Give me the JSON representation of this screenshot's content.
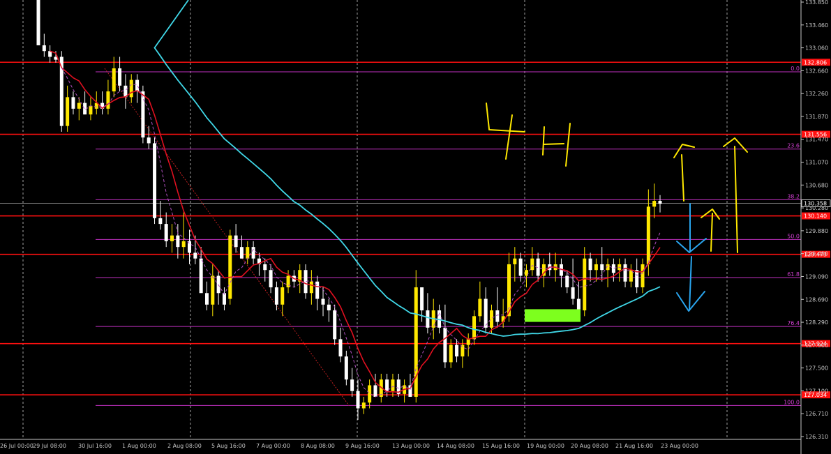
{
  "chart_data": {
    "type": "candlestick",
    "timeframe_annotation": "4H",
    "x_tick_labels": [
      "26 Jul 00:00",
      "29 Jul 08:00",
      "30 Jul 16:00",
      "1 Aug 00:00",
      "2 Aug 08:00",
      "5 Aug 16:00",
      "7 Aug 00:00",
      "8 Aug 08:00",
      "9 Aug 16:00",
      "13 Aug 00:00",
      "14 Aug 08:00",
      "15 Aug 16:00",
      "19 Aug 00:00",
      "20 Aug 08:00",
      "21 Aug 16:00",
      "23 Aug 00:00"
    ],
    "y_tick_labels": [
      "133.850",
      "133.460",
      "133.060",
      "132.660",
      "132.260",
      "131.870",
      "131.470",
      "131.070",
      "130.680",
      "130.280",
      "129.880",
      "129.490",
      "129.090",
      "128.690",
      "128.290",
      "127.900",
      "127.500",
      "127.100",
      "126.710",
      "126.310"
    ],
    "ylim": [
      126.2,
      133.95
    ],
    "current_price": 130.358,
    "horizontal_levels": [
      132.806,
      131.556,
      130.14,
      129.473,
      127.924,
      127.034
    ],
    "fibonacci_levels": [
      {
        "label": "0.0",
        "price": 132.64
      },
      {
        "label": "23.6",
        "price": 131.3
      },
      {
        "label": "38.2",
        "price": 130.42
      },
      {
        "label": "50.0",
        "price": 129.73
      },
      {
        "label": "61.8",
        "price": 129.07
      },
      {
        "label": "76.4",
        "price": 128.22
      },
      {
        "label": "100.0",
        "price": 126.85
      }
    ],
    "candles": [
      [
        133.9,
        134.1,
        133.7,
        133.1
      ],
      [
        133.1,
        133.3,
        132.9,
        133.0
      ],
      [
        133.0,
        133.1,
        132.8,
        132.9
      ],
      [
        132.9,
        133.0,
        132.8,
        132.85
      ],
      [
        132.9,
        133.0,
        131.6,
        131.7
      ],
      [
        131.7,
        132.4,
        131.6,
        132.2
      ],
      [
        132.2,
        132.3,
        131.9,
        132.0
      ],
      [
        132.0,
        132.2,
        131.8,
        132.1
      ],
      [
        132.1,
        132.3,
        131.9,
        131.9
      ],
      [
        131.9,
        132.2,
        131.8,
        132.05
      ],
      [
        132.0,
        132.3,
        131.9,
        132.1
      ],
      [
        132.1,
        132.3,
        131.9,
        132.0
      ],
      [
        132.0,
        132.5,
        131.9,
        132.3
      ],
      [
        132.3,
        132.9,
        132.2,
        132.7
      ],
      [
        132.7,
        132.9,
        132.3,
        132.4
      ],
      [
        132.4,
        132.6,
        132.0,
        132.2
      ],
      [
        132.2,
        132.6,
        132.1,
        132.5
      ],
      [
        132.5,
        132.6,
        132.1,
        132.3
      ],
      [
        132.3,
        132.4,
        131.4,
        131.5
      ],
      [
        131.5,
        131.7,
        131.3,
        131.4
      ],
      [
        131.4,
        131.5,
        130.0,
        130.1
      ],
      [
        130.1,
        130.4,
        129.9,
        130.0
      ],
      [
        130.0,
        130.2,
        129.6,
        129.7
      ],
      [
        129.7,
        130.0,
        129.5,
        129.8
      ],
      [
        129.8,
        130.0,
        129.4,
        129.6
      ],
      [
        129.6,
        130.2,
        129.4,
        129.7
      ],
      [
        129.7,
        129.9,
        129.3,
        129.5
      ],
      [
        129.5,
        129.8,
        129.3,
        129.4
      ],
      [
        129.4,
        129.6,
        128.9,
        128.8
      ],
      [
        128.8,
        129.0,
        128.5,
        128.6
      ],
      [
        128.6,
        129.3,
        128.4,
        129.1
      ],
      [
        129.1,
        129.2,
        128.6,
        128.8
      ],
      [
        128.8,
        128.9,
        128.5,
        128.6
      ],
      [
        128.7,
        129.9,
        128.6,
        129.8
      ],
      [
        129.8,
        130.0,
        129.5,
        129.6
      ],
      [
        129.6,
        129.8,
        129.4,
        129.4
      ],
      [
        129.4,
        129.7,
        129.3,
        129.6
      ],
      [
        129.6,
        129.7,
        129.3,
        129.4
      ],
      [
        129.4,
        129.5,
        129.1,
        129.3
      ],
      [
        129.3,
        129.4,
        129.0,
        129.2
      ],
      [
        129.2,
        129.3,
        128.8,
        128.9
      ],
      [
        128.9,
        129.0,
        128.5,
        128.6
      ],
      [
        128.6,
        129.0,
        128.4,
        128.9
      ],
      [
        128.9,
        129.2,
        128.8,
        129.1
      ],
      [
        129.1,
        129.2,
        128.9,
        129.0
      ],
      [
        129.0,
        129.3,
        128.8,
        129.2
      ],
      [
        129.2,
        129.3,
        128.7,
        128.8
      ],
      [
        128.8,
        129.2,
        128.6,
        129.0
      ],
      [
        129.0,
        129.1,
        128.5,
        128.7
      ],
      [
        128.7,
        128.9,
        128.4,
        128.6
      ],
      [
        128.6,
        128.7,
        128.3,
        128.5
      ],
      [
        128.5,
        128.6,
        127.9,
        128.0
      ],
      [
        128.0,
        128.2,
        127.6,
        127.7
      ],
      [
        127.7,
        127.8,
        127.2,
        127.3
      ],
      [
        127.3,
        127.5,
        127.0,
        127.1
      ],
      [
        127.1,
        127.3,
        126.6,
        126.8
      ],
      [
        126.8,
        127.0,
        126.7,
        126.9
      ],
      [
        126.9,
        127.3,
        126.8,
        127.2
      ],
      [
        127.2,
        127.4,
        127.0,
        127.0
      ],
      [
        127.0,
        127.4,
        126.9,
        127.3
      ],
      [
        127.3,
        127.4,
        127.0,
        127.1
      ],
      [
        127.1,
        127.4,
        127.0,
        127.3
      ],
      [
        127.3,
        127.4,
        127.0,
        127.05
      ],
      [
        127.05,
        127.3,
        126.9,
        127.2
      ],
      [
        127.2,
        127.4,
        127.0,
        127.0
      ],
      [
        127.0,
        129.2,
        126.9,
        128.9
      ],
      [
        128.9,
        128.9,
        128.3,
        128.5
      ],
      [
        128.5,
        128.8,
        128.1,
        128.2
      ],
      [
        128.2,
        128.7,
        128.0,
        128.5
      ],
      [
        128.5,
        128.6,
        128.1,
        128.2
      ],
      [
        128.2,
        128.6,
        127.5,
        127.6
      ],
      [
        127.6,
        128.0,
        127.5,
        127.9
      ],
      [
        127.9,
        128.0,
        127.6,
        127.7
      ],
      [
        127.7,
        128.0,
        127.5,
        127.9
      ],
      [
        127.9,
        128.1,
        127.7,
        128.0
      ],
      [
        128.0,
        128.5,
        127.9,
        128.4
      ],
      [
        128.4,
        129.0,
        128.3,
        128.7
      ],
      [
        128.7,
        128.9,
        128.1,
        128.2
      ],
      [
        128.2,
        128.6,
        128.1,
        128.5
      ],
      [
        128.5,
        128.9,
        128.2,
        128.3
      ],
      [
        128.3,
        128.7,
        128.2,
        128.4
      ],
      [
        128.4,
        129.5,
        128.3,
        129.3
      ],
      [
        129.3,
        129.6,
        129.0,
        129.4
      ],
      [
        129.4,
        129.5,
        129.0,
        129.1
      ],
      [
        129.1,
        129.3,
        128.9,
        129.2
      ],
      [
        129.2,
        129.6,
        129.1,
        129.4
      ],
      [
        129.4,
        129.5,
        129.0,
        129.1
      ],
      [
        129.1,
        129.4,
        128.9,
        129.3
      ],
      [
        129.3,
        129.5,
        129.1,
        129.2
      ],
      [
        129.2,
        129.5,
        129.0,
        129.3
      ],
      [
        129.3,
        129.4,
        128.9,
        129.1
      ],
      [
        129.1,
        129.2,
        128.8,
        128.9
      ],
      [
        128.9,
        129.4,
        128.6,
        128.7
      ],
      [
        128.7,
        129.0,
        128.4,
        128.5
      ],
      [
        128.5,
        129.6,
        128.4,
        129.4
      ],
      [
        129.4,
        129.5,
        129.0,
        129.2
      ],
      [
        129.2,
        129.4,
        129.0,
        129.3
      ],
      [
        129.3,
        129.6,
        129.0,
        129.2
      ],
      [
        129.2,
        129.4,
        128.9,
        129.3
      ],
      [
        129.3,
        129.4,
        129.0,
        129.15
      ],
      [
        129.2,
        129.4,
        129.0,
        129.3
      ],
      [
        129.3,
        129.4,
        128.9,
        129.0
      ],
      [
        129.0,
        129.3,
        128.9,
        129.2
      ],
      [
        129.2,
        129.4,
        128.8,
        128.9
      ],
      [
        128.9,
        129.4,
        128.8,
        129.3
      ],
      [
        129.3,
        130.6,
        129.1,
        130.3
      ],
      [
        130.3,
        130.7,
        130.1,
        130.4
      ],
      [
        130.4,
        130.5,
        130.2,
        130.35
      ]
    ]
  }
}
